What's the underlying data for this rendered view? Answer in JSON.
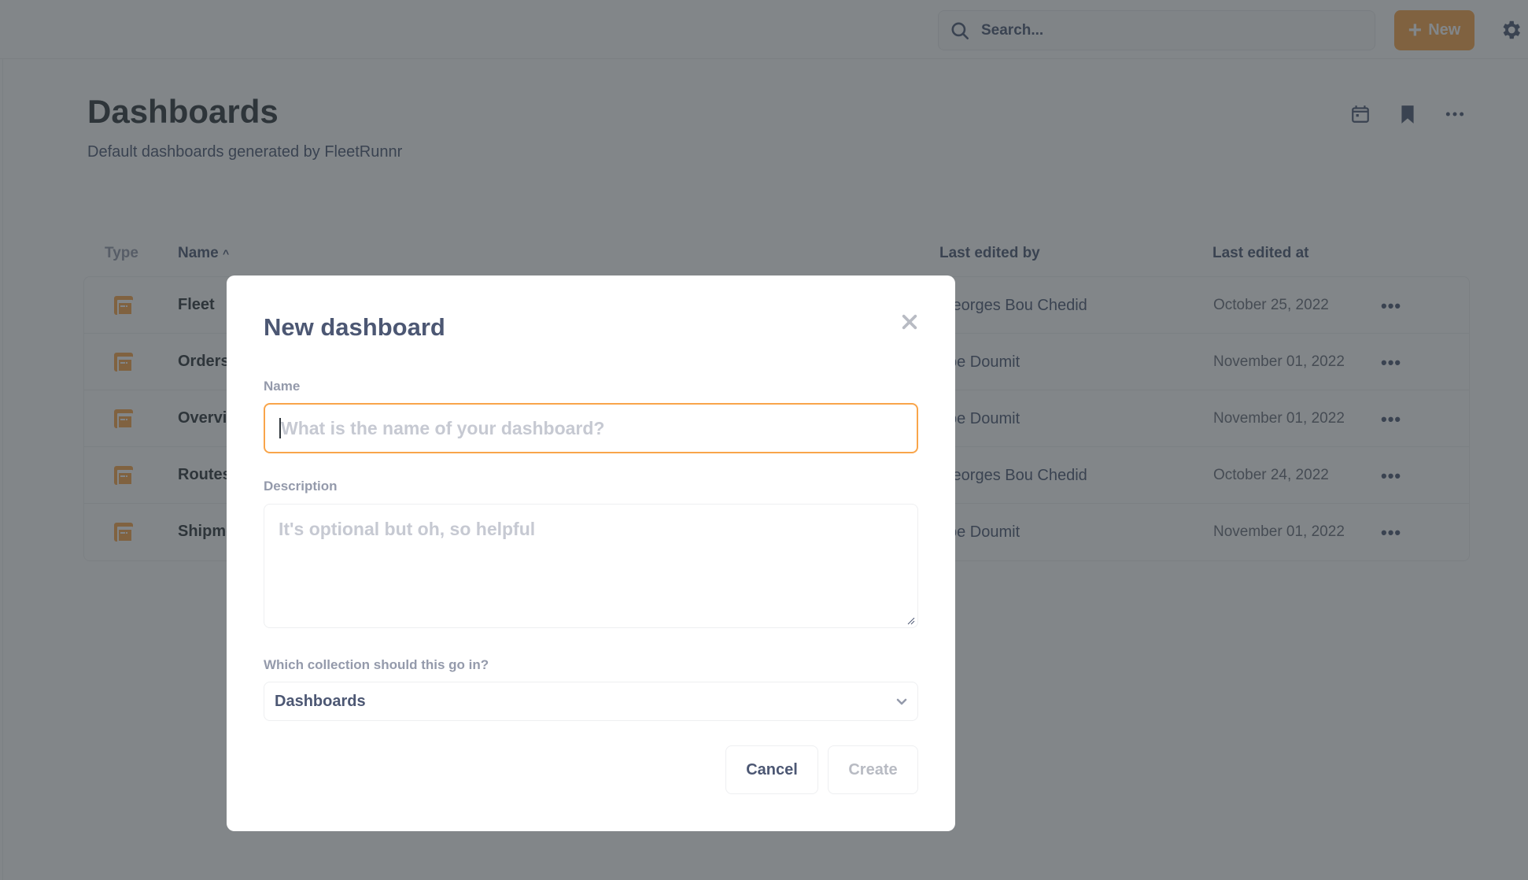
{
  "topbar": {
    "search_placeholder": "Search...",
    "new_button_label": "New",
    "new_button_icon": "plus-icon",
    "settings_icon": "gear-icon"
  },
  "page": {
    "title": "Dashboards",
    "subtitle": "Default dashboards generated by FleetRunnr",
    "header_icons": [
      "calendar-icon",
      "bookmark-icon",
      "more-icon"
    ]
  },
  "table": {
    "columns": {
      "type": "Type",
      "name": "Name",
      "name_sort": "^",
      "last_edited_by": "Last edited by",
      "last_edited_at": "Last edited at"
    },
    "rows": [
      {
        "name": "Fleet",
        "last_edited_by": "Georges Bou Chedid",
        "last_edited_at": "October 25, 2022",
        "more": "•••"
      },
      {
        "name": "Orders",
        "last_edited_by": "Joe Doumit",
        "last_edited_at": "November 01, 2022",
        "more": "•••"
      },
      {
        "name": "Overview",
        "last_edited_by": "Joe Doumit",
        "last_edited_at": "November 01, 2022",
        "more": "•••"
      },
      {
        "name": "Routes",
        "last_edited_by": "Georges Bou Chedid",
        "last_edited_at": "October 24, 2022",
        "more": "•••"
      },
      {
        "name": "Shipments",
        "last_edited_by": "Joe Doumit",
        "last_edited_at": "November 01, 2022",
        "more": "•••"
      }
    ]
  },
  "modal": {
    "title": "New dashboard",
    "name_label": "Name",
    "name_placeholder": "What is the name of your dashboard?",
    "name_value": "",
    "description_label": "Description",
    "description_placeholder": "It's optional but oh, so helpful",
    "description_value": "",
    "collection_label": "Which collection should this go in?",
    "collection_selected": "Dashboards",
    "cancel_label": "Cancel",
    "create_label": "Create"
  },
  "colors": {
    "brand": "#f9a54a",
    "text": "#4c5773",
    "muted": "#949aab"
  }
}
